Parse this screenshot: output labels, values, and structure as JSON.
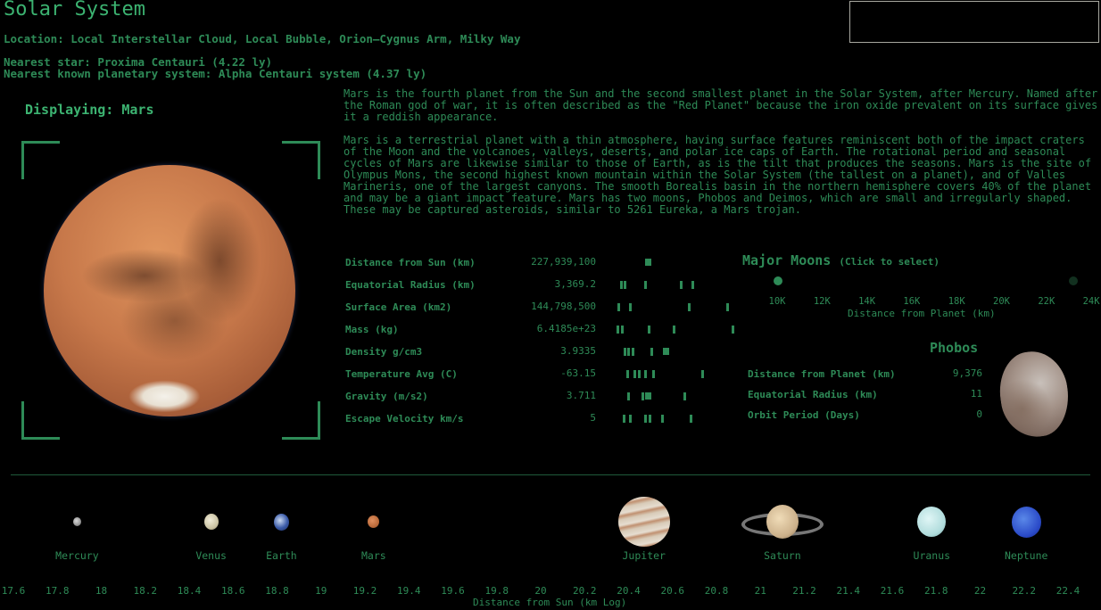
{
  "header": {
    "title": "Solar System",
    "location": "Location: Local Interstellar Cloud, Local Bubble, Orion–Cygnus Arm, Milky Way",
    "nearest_star": "Nearest star: Proxima Centauri (4.22 ly)",
    "nearest_system": "Nearest known planetary system: Alpha Centauri system (4.37 ly)"
  },
  "search": {
    "value": "",
    "placeholder": ""
  },
  "viewer": {
    "displaying_label": "Displaying: Mars",
    "planet": "Mars"
  },
  "description": {
    "paragraphs": [
      "Mars is the fourth planet from the Sun and the second smallest planet in the Solar System, after Mercury. Named after the Roman god of war, it is often described as the \"Red Planet\" because the iron oxide prevalent on its surface gives it a reddish appearance.",
      "Mars is a terrestrial planet with a thin atmosphere, having surface features reminiscent both of the impact craters of the Moon and the volcanoes, valleys, deserts, and polar ice caps of Earth. The rotational period and seasonal cycles of Mars are likewise similar to those of Earth, as is the tilt that produces the seasons. Mars is the site of Olympus Mons, the second highest known mountain within the Solar System (the tallest on a planet), and of Valles Marineris, one of the largest canyons. The smooth Borealis basin in the northern hemisphere covers 40% of the planet and may be a giant impact feature. Mars has two moons, Phobos and Deimos, which are small and irregularly shaped. These may be captured asteroids, similar to 5261 Eureka, a Mars trojan."
    ]
  },
  "stats": [
    {
      "label": "Distance from Sun (km)",
      "value": "227,939,100",
      "ticks": [
        0.25
      ],
      "selected": 0
    },
    {
      "label": "Equatorial Radius (km)",
      "value": "3,369.2",
      "ticks": [
        0.05,
        0.08,
        0.24,
        0.53,
        0.62
      ],
      "selected": -1
    },
    {
      "label": "Surface Area (km2)",
      "value": "144,798,500",
      "ticks": [
        0.03,
        0.12,
        0.59,
        0.9
      ],
      "selected": -1
    },
    {
      "label": "Mass (kg)",
      "value": "6.4185e+23",
      "ticks": [
        0.02,
        0.06,
        0.27,
        0.47,
        0.94
      ],
      "selected": -1
    },
    {
      "label": "Density g/cm3",
      "value": "3.9335",
      "ticks": [
        0.08,
        0.11,
        0.14,
        0.29,
        0.39
      ],
      "selected": 4
    },
    {
      "label": "Temperature Avg (C)",
      "value": "-63.15",
      "ticks": [
        0.1,
        0.16,
        0.19,
        0.24,
        0.31,
        0.7
      ],
      "selected": -1
    },
    {
      "label": "Gravity (m/s2)",
      "value": "3.711",
      "ticks": [
        0.11,
        0.22,
        0.25,
        0.56
      ],
      "selected": 2
    },
    {
      "label": "Escape Velocity km/s",
      "value": "5",
      "ticks": [
        0.07,
        0.12,
        0.24,
        0.28,
        0.38,
        0.61
      ],
      "selected": -1
    }
  ],
  "moons": {
    "title": "Major Moons",
    "subtitle": "(Click to select)",
    "axis_label": "Distance from Planet (km)",
    "axis_ticks": [
      "10K",
      "12K",
      "14K",
      "16K",
      "18K",
      "20K",
      "22K",
      "24K"
    ],
    "axis_range": [
      8500,
      24000
    ],
    "items": [
      {
        "name": "Phobos",
        "distance_km": 9376,
        "selected": true,
        "color": "#2e8b57"
      },
      {
        "name": "Deimos",
        "distance_km": 23460,
        "selected": false,
        "color": "#12301f"
      }
    ],
    "selected": {
      "name": "Phobos",
      "stats": [
        {
          "label": "Distance from Planet (km)",
          "value": "9,376"
        },
        {
          "label": "Equatorial Radius (km)",
          "value": "11"
        },
        {
          "label": "Orbit Period (Days)",
          "value": "0"
        }
      ]
    }
  },
  "planets_axis": {
    "label": "Distance from Sun (km Log)",
    "ticks": [
      "17.6",
      "17.8",
      "18",
      "18.2",
      "18.4",
      "18.6",
      "18.8",
      "19",
      "19.2",
      "19.4",
      "19.6",
      "19.8",
      "20",
      "20.2",
      "20.4",
      "20.6",
      "20.8",
      "21",
      "21.2",
      "21.4",
      "21.6",
      "21.8",
      "22",
      "22.2",
      "22.4"
    ],
    "range": [
      17.6,
      22.4
    ]
  },
  "planets": [
    {
      "name": "Mercury",
      "log_distance": 17.89
    },
    {
      "name": "Venus",
      "log_distance": 18.5
    },
    {
      "name": "Earth",
      "log_distance": 18.82
    },
    {
      "name": "Mars",
      "log_distance": 19.24
    },
    {
      "name": "Jupiter",
      "log_distance": 20.47
    },
    {
      "name": "Saturn",
      "log_distance": 21.1
    },
    {
      "name": "Uranus",
      "log_distance": 21.78
    },
    {
      "name": "Neptune",
      "log_distance": 22.21
    }
  ],
  "colors": {
    "accent": "#2e8b57",
    "title": "#3cb371",
    "background": "#000000"
  }
}
